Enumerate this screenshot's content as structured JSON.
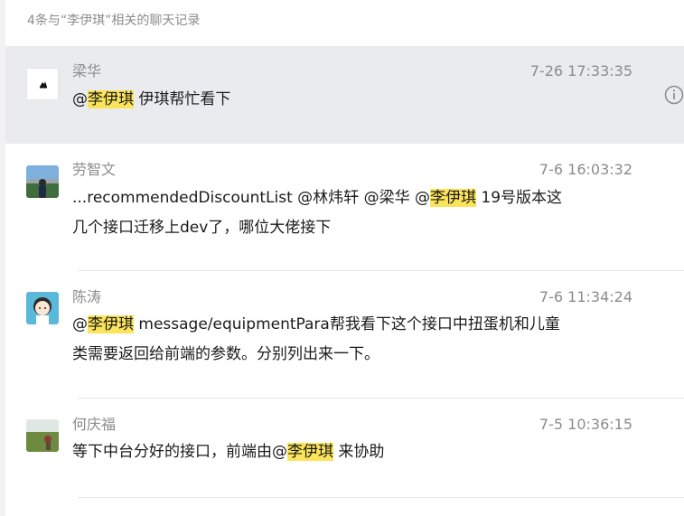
{
  "header": {
    "text": "4条与“李伊琪”相关的聊天记录"
  },
  "results": [
    {
      "name": "梁华",
      "time": "7-26 17:33:35",
      "msg1": {
        "pre": "@",
        "hl": "李伊琪",
        "post": " 伊琪帮忙看下"
      }
    },
    {
      "name": "劳智文",
      "time": "7-6 16:03:32",
      "msg1": {
        "pre": "...recommendedDiscountList @林炜轩 @梁华 @",
        "hl": "李伊琪",
        "post": " 19号版本这"
      },
      "msg2": "几个接口迁移上dev了，哪位大佬接下"
    },
    {
      "name": "陈涛",
      "time": "7-6 11:34:24",
      "msg1": {
        "pre": "@",
        "hl": "李伊琪",
        "post": " message/equipmentPara帮我看下这个接口中扭蛋机和儿童"
      },
      "msg2": "类需要返回给前端的参数。分别列出来一下。"
    },
    {
      "name": "何庆福",
      "time": "7-5 10:36:15",
      "msg1": {
        "pre": "等下中台分好的接口，前端由@",
        "hl": "李伊琪",
        "post": " 来协助"
      }
    }
  ],
  "icons": {
    "info": "info-circle-icon"
  },
  "colors": {
    "highlight": "#fbe45a",
    "selected_bg": "#e9ebee"
  }
}
